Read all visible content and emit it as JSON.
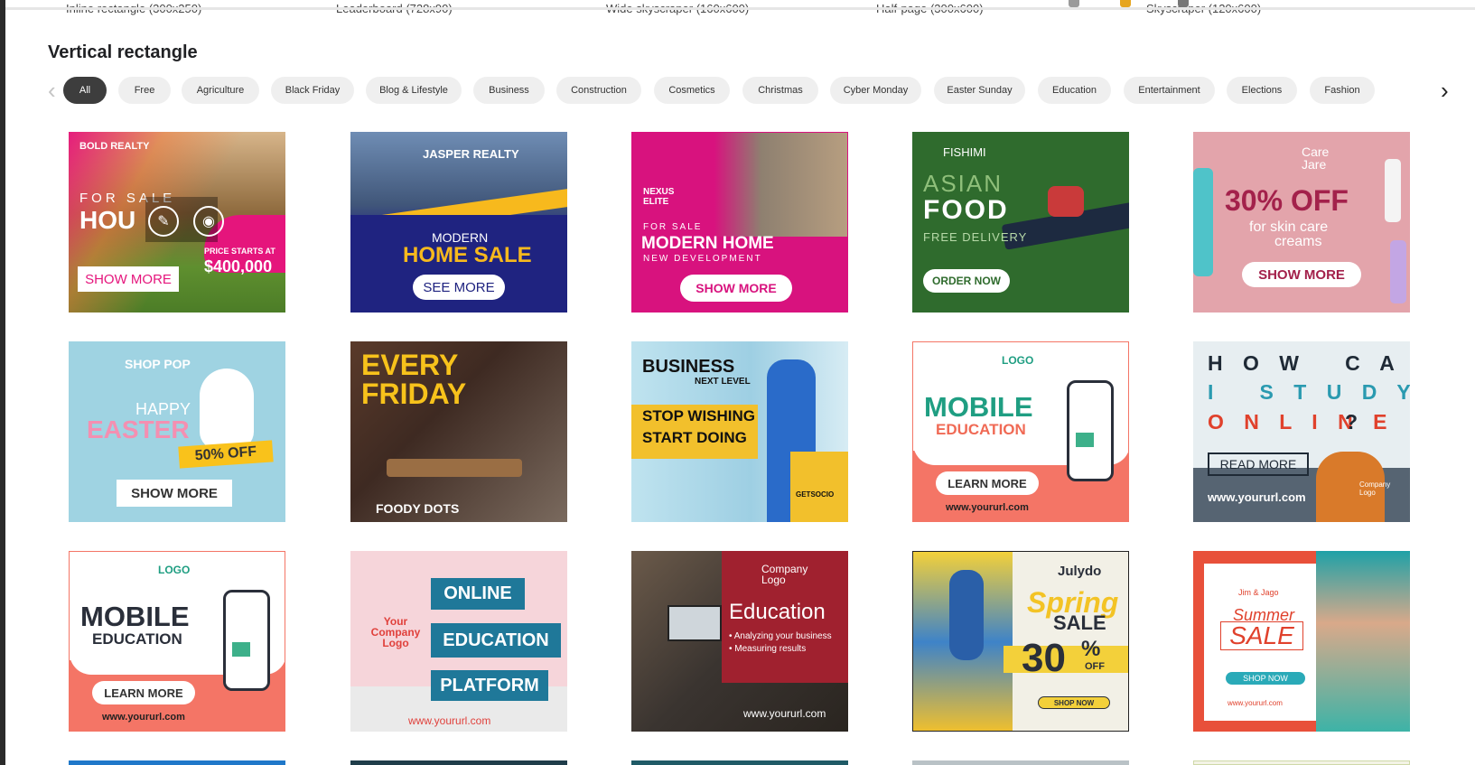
{
  "top_labels": [
    "Inline rectangle (300x250)",
    "Leaderboard (728x90)",
    "Wide skyscraper (160x600)",
    "Half-page (300x600)",
    "Skyscraper (120x600)"
  ],
  "section_title": "Vertical rectangle",
  "categories": [
    "All",
    "Free",
    "Agriculture",
    "Black Friday",
    "Blog & Lifestyle",
    "Business",
    "Construction",
    "Cosmetics",
    "Christmas",
    "Cyber Monday",
    "Easter Sunday",
    "Education",
    "Entertainment",
    "Elections",
    "Fashion"
  ],
  "selected_category": "All",
  "icons": {
    "prev": "chevron-left-icon",
    "next": "chevron-right-icon",
    "edit": "pencil-icon",
    "preview": "eye-icon"
  },
  "colors": {
    "chip_active": "#3d3d3d",
    "chip_bg": "#efefef",
    "magenta": "#e5157c",
    "navy": "#1f2380",
    "green": "#2f6b2d",
    "coral": "#f47566"
  },
  "templates": [
    {
      "brand": "BOLD REALTY",
      "line1": "FOR SALE",
      "line2": "HOU",
      "price_label": "PRICE STARTS AT",
      "price": "$400,000",
      "cta": "SHOW MORE"
    },
    {
      "brand": "JASPER REALTY",
      "line1": "MODERN",
      "line2": "HOME SALE",
      "cta": "SEE MORE"
    },
    {
      "brand": "NEXUS ELITE",
      "line1": "FOR SALE",
      "line2": "MODERN HOME",
      "line3": "NEW DEVELOPMENT",
      "cta": "SHOW MORE"
    },
    {
      "brand": "FISHIMI",
      "line1": "ASIAN",
      "line2": "FOOD",
      "line3": "FREE DELIVERY",
      "cta": "ORDER NOW"
    },
    {
      "brand": "Care Jare",
      "line1": "30% OFF",
      "line2": "for skin care",
      "line3": "creams",
      "cta": "SHOW MORE"
    },
    {
      "brand": "SHOP POP",
      "line1": "HAPPY",
      "line2": "EASTER",
      "badge": "50% OFF",
      "cta": "SHOW MORE"
    },
    {
      "brand": "FOODY DOTS",
      "line1": "EVERY",
      "line2": "FRIDAY"
    },
    {
      "brand": "GETSOCIO",
      "line1": "BUSINESS",
      "line2": "NEXT LEVEL",
      "line3": "STOP WISHING",
      "line4": "START DOING"
    },
    {
      "brand": "LOGO",
      "line1": "MOBILE",
      "line2": "EDUCATION",
      "cta": "LEARN MORE",
      "url": "www.yoururl.com"
    },
    {
      "line1": "H O W   C A N",
      "line2": "I   S T U D Y",
      "line3": "O N L I N E",
      "line4": "?",
      "cta": "READ MORE",
      "url": "www.yoururl.com",
      "logo": "Company Logo"
    },
    {
      "brand": "LOGO",
      "line1": "MOBILE",
      "line2": "EDUCATION",
      "cta": "LEARN MORE",
      "url": "www.yoururl.com"
    },
    {
      "brand": "Your Company Logo",
      "line1": "ONLINE",
      "line2": "EDUCATION",
      "line3": "PLATFORM",
      "url": "www.yoururl.com"
    },
    {
      "brand": "Company Logo",
      "line1": "Education",
      "line2": "• Analyzing your business",
      "line3": "• Measuring results",
      "url": "www.yoururl.com"
    },
    {
      "brand": "Julydo",
      "line1": "Spring",
      "line2": "SALE",
      "line3": "30",
      "line4": "%",
      "line5": "OFF",
      "cta": "SHOP NOW"
    },
    {
      "brand": "Jim & Jago",
      "line1": "Summer",
      "line2": "SALE",
      "cta": "SHOP NOW",
      "url": "www.yoururl.com"
    }
  ]
}
